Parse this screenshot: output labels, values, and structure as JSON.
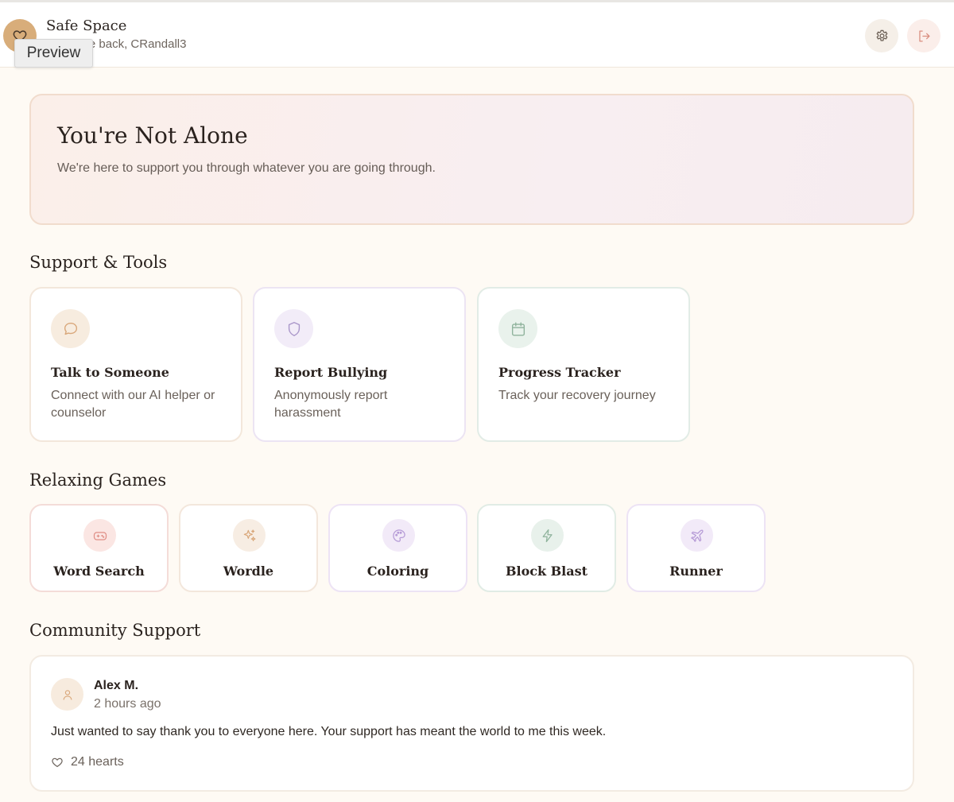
{
  "header": {
    "title": "Safe Space",
    "welcome": "Welcome back, CRandall3",
    "tooltip": "Preview",
    "icons": {
      "logo": "heart-icon",
      "settings": "gear-icon",
      "logout": "logout-icon"
    }
  },
  "hero": {
    "title": "You're Not Alone",
    "subtitle": "We're here to support you through whatever you are going through."
  },
  "support": {
    "heading": "Support & Tools",
    "cards": [
      {
        "title": "Talk to Someone",
        "desc": "Connect with our AI helper or counselor",
        "icon": "chat-bubble-icon",
        "color": "#d9a77a"
      },
      {
        "title": "Report Bullying",
        "desc": "Anonymously report harassment",
        "icon": "shield-icon",
        "color": "#a996c9"
      },
      {
        "title": "Progress Tracker",
        "desc": "Track your recovery journey",
        "icon": "calendar-icon",
        "color": "#8fb39c"
      }
    ]
  },
  "games": {
    "heading": "Relaxing Games",
    "items": [
      {
        "label": "Word Search",
        "icon": "gamepad-icon"
      },
      {
        "label": "Wordle",
        "icon": "sparkles-icon"
      },
      {
        "label": "Coloring",
        "icon": "palette-icon"
      },
      {
        "label": "Block Blast",
        "icon": "lightning-icon"
      },
      {
        "label": "Runner",
        "icon": "plane-icon"
      }
    ]
  },
  "community": {
    "heading": "Community Support",
    "posts": [
      {
        "author": "Alex M.",
        "time": "2 hours ago",
        "text": "Just wanted to say thank you to everyone here. Your support has meant the world to me this week.",
        "hearts": "24 hearts"
      }
    ]
  }
}
